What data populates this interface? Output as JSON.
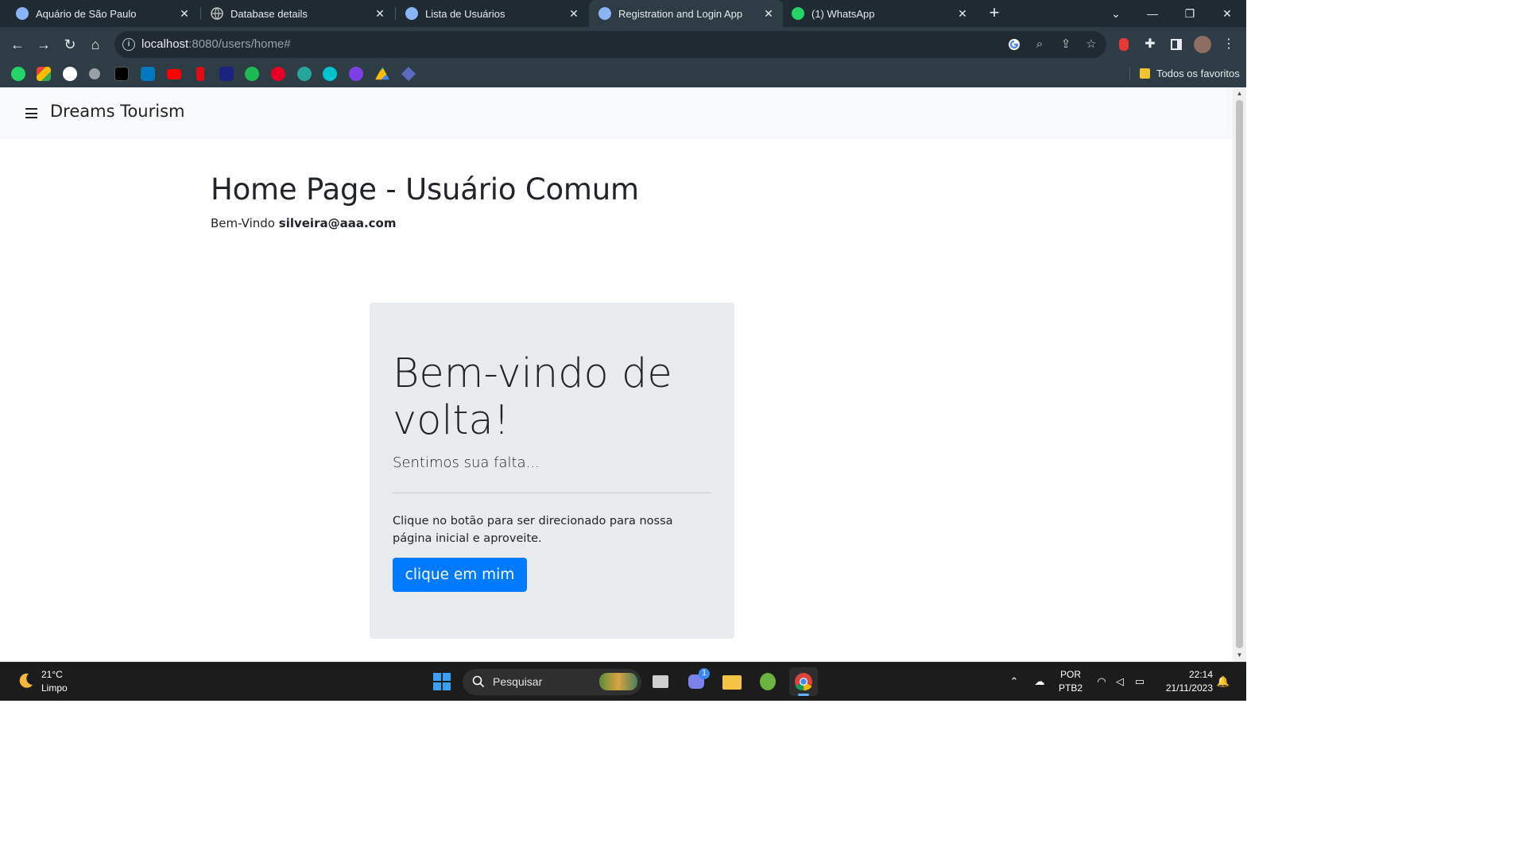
{
  "browser": {
    "tabs": [
      {
        "title": "Aquário de São Paulo",
        "active": false
      },
      {
        "title": "Database details",
        "active": false
      },
      {
        "title": "Lista de Usuários",
        "active": false
      },
      {
        "title": "Registration and Login App",
        "active": true
      },
      {
        "title": "(1) WhatsApp",
        "active": false
      }
    ],
    "url_host": "localhost",
    "url_rest": ":8080/users/home#",
    "bookmarks_folder_label": "Todos os favoritos",
    "whatsapp_badge": "1"
  },
  "page": {
    "brand": "Dreams Tourism",
    "heading": "Home Page - Usuário Comum",
    "welcome_prefix": "Bem-Vindo",
    "user_email": "silveira@aaa.com",
    "jumbotron": {
      "title": "Bem-vindo de volta!",
      "lead": "Sentimos sua falta...",
      "text": "Clique no botão para ser direcionado para nossa página inicial e aproveite.",
      "button_label": "clique em mim"
    },
    "colors": {
      "primary_button": "#007bff",
      "jumbotron_bg": "#e9ecef",
      "navbar_bg": "#f8f9fa"
    }
  },
  "taskbar": {
    "weather_temp": "21°C",
    "weather_condition": "Limpo",
    "search_placeholder": "Pesquisar",
    "teams_badge": "1",
    "language_line1": "POR",
    "language_line2": "PTB2",
    "time": "22:14",
    "date": "21/11/2023"
  }
}
